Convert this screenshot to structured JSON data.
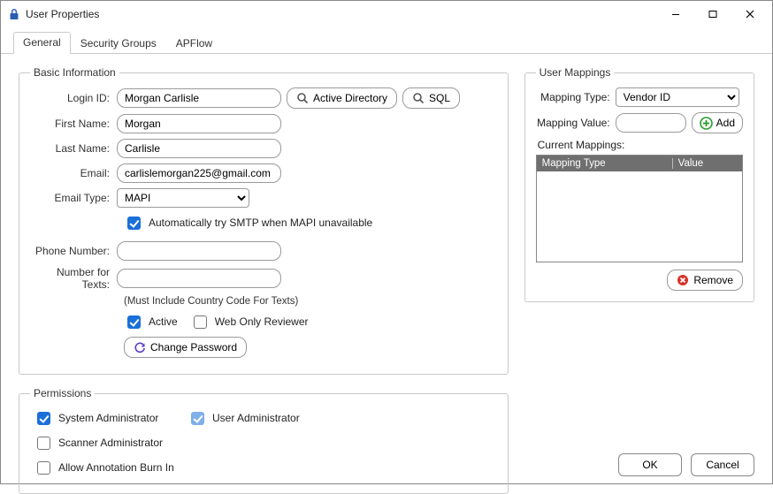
{
  "window": {
    "title": "User Properties"
  },
  "tabs": {
    "general": "General",
    "security_groups": "Security Groups",
    "apflow": "APFlow"
  },
  "basic_info": {
    "legend": "Basic Information",
    "login_id_label": "Login ID:",
    "login_id_value": "Morgan Carlisle",
    "ad_button": "Active Directory",
    "sql_button": "SQL",
    "first_name_label": "First Name:",
    "first_name_value": "Morgan",
    "last_name_label": "Last Name:",
    "last_name_value": "Carlisle",
    "email_label": "Email:",
    "email_value": "carlislemorgan225@gmail.com",
    "email_type_label": "Email Type:",
    "email_type_value": "MAPI",
    "auto_smtp_label": "Automatically try SMTP when MAPI unavailable",
    "phone_label": "Phone Number:",
    "phone_value": "",
    "text_number_label": "Number for Texts:",
    "text_number_value": "",
    "text_number_note": "(Must Include Country Code For Texts)",
    "active_label": "Active",
    "web_only_label": "Web Only Reviewer",
    "change_password_label": "Change Password"
  },
  "permissions": {
    "legend": "Permissions",
    "sysadmin": "System Administrator",
    "useradmin": "User Administrator",
    "scanneradmin": "Scanner Administrator",
    "allow_burn": "Allow Annotation Burn In"
  },
  "user_mappings": {
    "legend": "User Mappings",
    "type_label": "Mapping Type:",
    "type_value": "Vendor ID",
    "value_label": "Mapping Value:",
    "value_value": "",
    "add_button": "Add",
    "current_label": "Current Mappings:",
    "col_type": "Mapping Type",
    "col_value": "Value",
    "remove_button": "Remove"
  },
  "buttons": {
    "ok": "OK",
    "cancel": "Cancel"
  }
}
